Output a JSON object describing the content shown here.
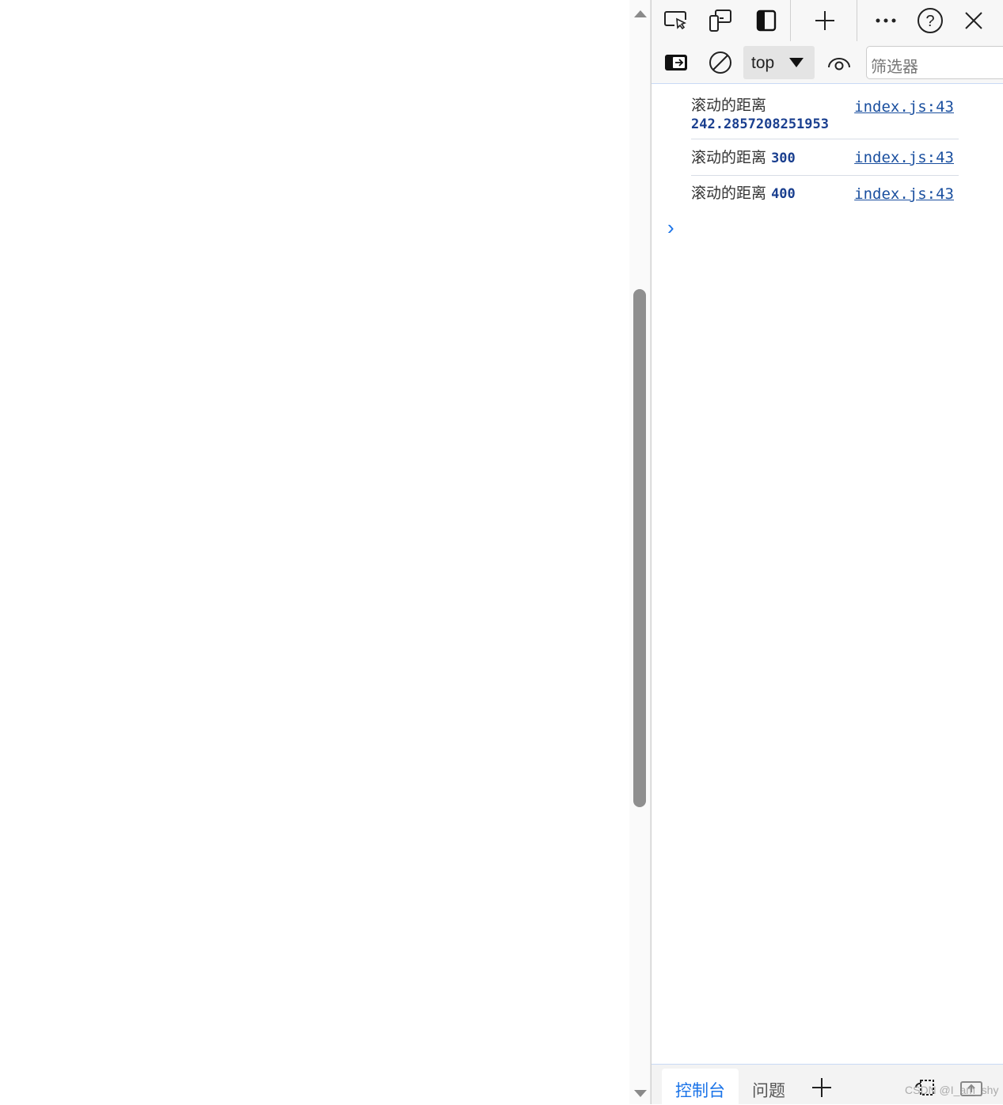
{
  "devtools": {
    "toolbar": {
      "icons": [
        "inspect-element-icon",
        "device-emulation-icon",
        "dock-side-icon",
        "add-tool-icon",
        "more-icon",
        "help-icon",
        "close-icon"
      ]
    },
    "console_toolbar": {
      "context_selector": "top",
      "filter_placeholder": "筛选器"
    },
    "messages": [
      {
        "text": "滚动的距离",
        "value": "242.2857208251953",
        "source": "index.js:43"
      },
      {
        "text": "滚动的距离",
        "value": "300",
        "source": "index.js:43"
      },
      {
        "text": "滚动的距离",
        "value": "400",
        "source": "index.js:43"
      }
    ],
    "prompt_symbol": "›",
    "bottom_tabs": [
      {
        "label": "控制台",
        "active": true
      },
      {
        "label": "问题",
        "active": false
      }
    ],
    "watermark": "CSDN @I_am_shy",
    "accent_color": "#1a73e8"
  },
  "page_scrollbar": {
    "position_fraction": 0.36
  }
}
